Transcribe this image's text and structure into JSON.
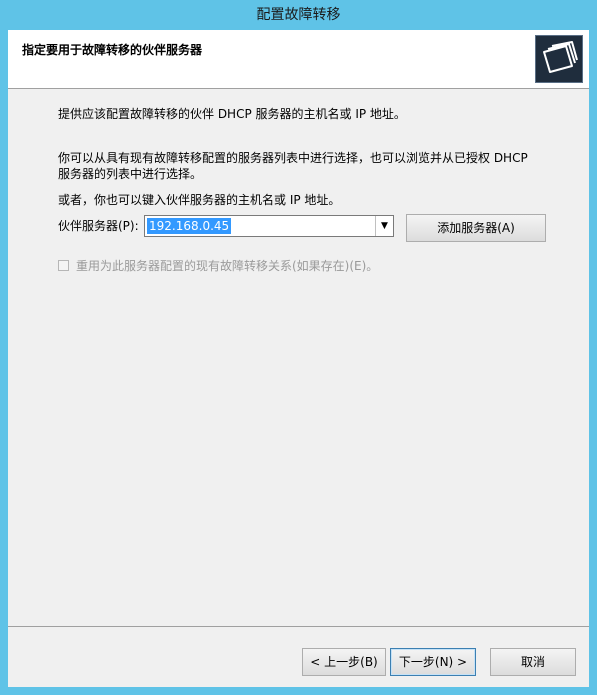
{
  "window": {
    "title": "配置故障转移"
  },
  "header": {
    "title": "指定要用于故障转移的伙伴服务器",
    "icon": "folder-stack-icon"
  },
  "body": {
    "intro": "提供应该配置故障转移的伙伴 DHCP 服务器的主机名或 IP 地址。",
    "para_line1": "你可以从具有现有故障转移配置的服务器列表中进行选择，也可以浏览并从已授权 DHCP",
    "para_line2": "服务器的列表中进行选择。",
    "or_text": "或者，你也可以键入伙伴服务器的主机名或 IP 地址。",
    "partner_label": "伙伴服务器(P):",
    "partner_value": "192.168.0.45",
    "add_server_label": "添加服务器(A)",
    "reuse_label": "重用为此服务器配置的现有故障转移关系(如果存在)(E)。",
    "reuse_checked": false
  },
  "footer": {
    "back_label": "< 上一步(B)",
    "next_label": "下一步(N) >",
    "cancel_label": "取消"
  }
}
